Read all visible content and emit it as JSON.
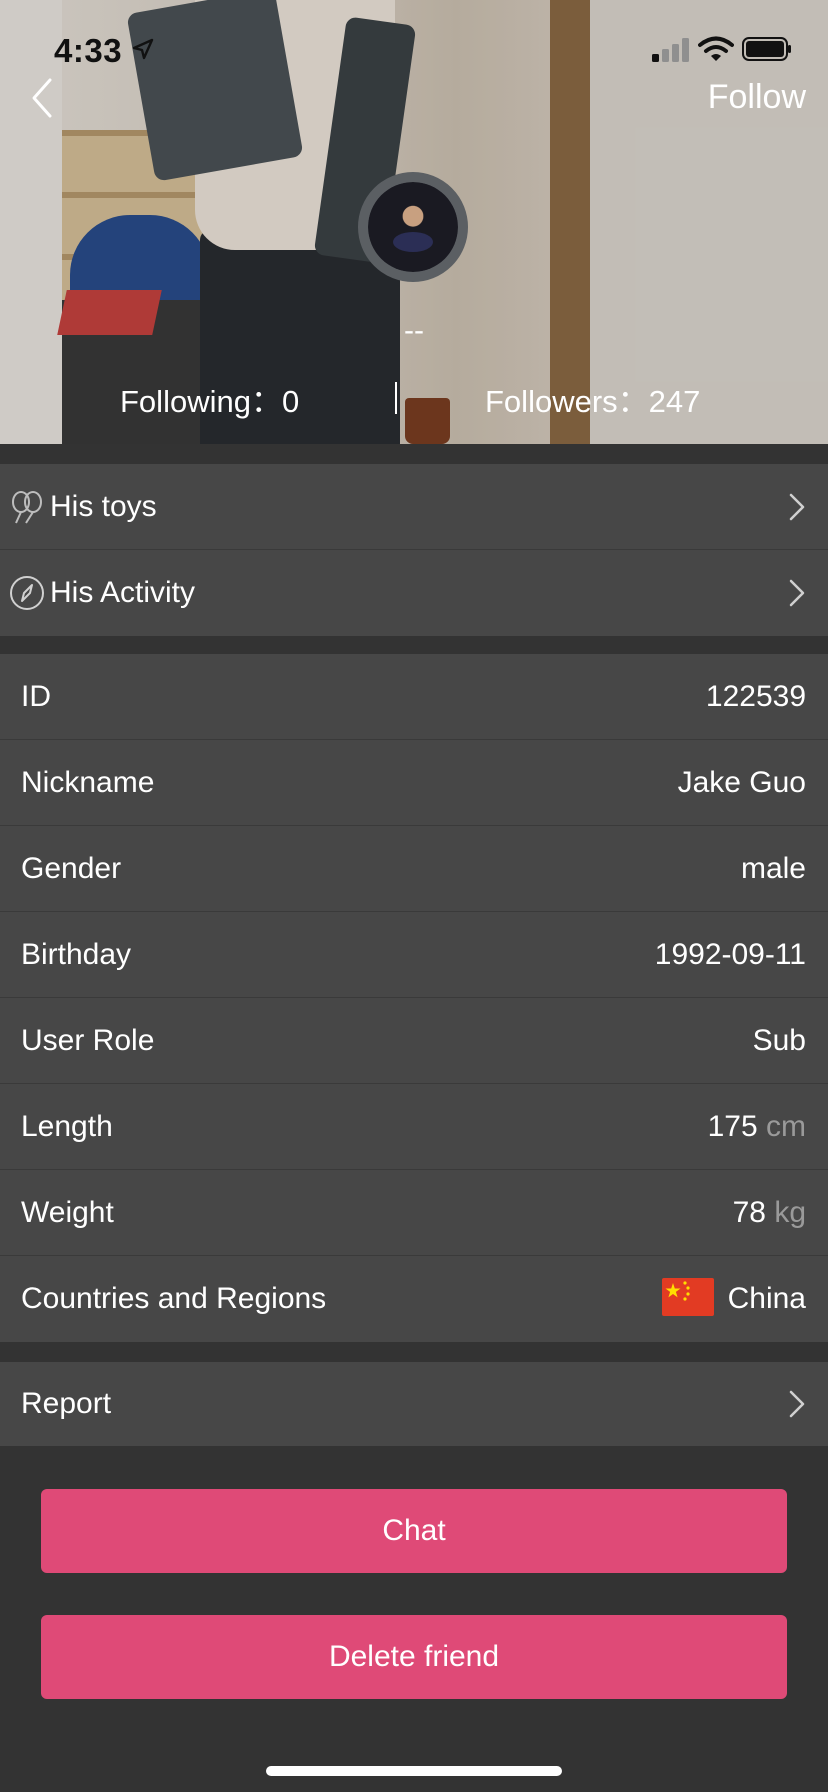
{
  "status_bar": {
    "time": "4:33"
  },
  "header": {
    "follow_label": "Follow",
    "nickname": "--",
    "following_label": "Following：",
    "following_count": "0",
    "followers_label": "Followers：",
    "followers_count": "247"
  },
  "nav": {
    "items": [
      {
        "label": "His toys",
        "icon": "toy-icon"
      },
      {
        "label": "His Activity",
        "icon": "compass-icon"
      }
    ]
  },
  "profile": {
    "rows": [
      {
        "label": "ID",
        "value": "122539"
      },
      {
        "label": "Nickname",
        "value": "Jake Guo"
      },
      {
        "label": "Gender",
        "value": "male"
      },
      {
        "label": "Birthday",
        "value": "1992-09-11"
      },
      {
        "label": "User Role",
        "value": "Sub"
      },
      {
        "label": "Length",
        "value": "175",
        "unit": "cm"
      },
      {
        "label": "Weight",
        "value": "78",
        "unit": "kg"
      },
      {
        "label": "Countries and Regions",
        "value": "China",
        "icon": "china-flag-icon"
      }
    ]
  },
  "report": {
    "label": "Report"
  },
  "actions": {
    "chat_label": "Chat",
    "delete_label": "Delete friend"
  },
  "colors": {
    "background": "#333333",
    "row_background": "#474747",
    "accent": "#df4a77",
    "unit_text": "#9a9a9a"
  }
}
